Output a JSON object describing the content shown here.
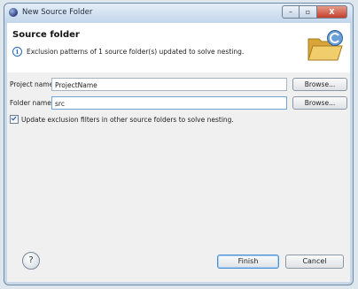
{
  "window": {
    "title": "New Source Folder",
    "min_glyph": "–",
    "max_glyph": "▫",
    "close_glyph": "X"
  },
  "header": {
    "heading": "Source folder",
    "message": "Exclusion patterns of 1 source folder(s) updated to solve nesting.",
    "info_glyph": "i"
  },
  "form": {
    "project_label": "Project name:",
    "project_value": "ProjectName",
    "folder_label": "Folder name:",
    "folder_value": "src",
    "browse_label": "Browse...",
    "checkbox_label": "Update exclusion filters in other source folders to solve nesting.",
    "checkbox_checked": true
  },
  "footer": {
    "help_glyph": "?",
    "finish_label": "Finish",
    "cancel_label": "Cancel"
  },
  "colors": {
    "accent": "#4a8ed6",
    "close_button": "#c2402c",
    "folder": "#e8b84a"
  }
}
